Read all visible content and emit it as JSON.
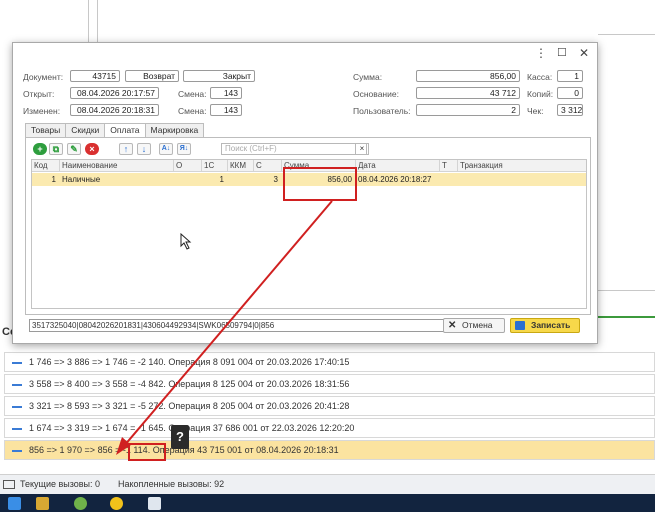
{
  "dialog": {
    "controls": {
      "more": "⋮",
      "maximize": "☐",
      "close": "✕"
    },
    "document": {
      "label": "Документ:",
      "number": "43715",
      "type": "Возврат",
      "state": "Закрыт"
    },
    "opened": {
      "label": "Открыт:",
      "value": "08.04.2026 20:17:57",
      "shift_label": "Смена:",
      "shift": "143"
    },
    "changed": {
      "label": "Изменен:",
      "value": "08.04.2026 20:18:31",
      "shift_label": "Смена:",
      "shift": "143"
    },
    "sum": {
      "label": "Сумма:",
      "value": "856,00"
    },
    "basis": {
      "label": "Основание:",
      "value": "43 712"
    },
    "user": {
      "label": "Пользователь:",
      "value": "2"
    },
    "cashbox": {
      "label": "Касса:",
      "value": "1"
    },
    "copies": {
      "label": "Копий:",
      "value": "0"
    },
    "check": {
      "label": "Чек:",
      "value": "3 312"
    },
    "tabs": [
      "Товары",
      "Скидки",
      "Оплата",
      "Маркировка"
    ],
    "search_placeholder": "Поиск (Ctrl+F)",
    "search_clear": "×",
    "grid": {
      "columns": [
        "Код",
        "Наименование",
        "О",
        "1С",
        "ККМ",
        "С",
        "Сумма",
        "Дата",
        "Т",
        "Транзакция"
      ],
      "row": {
        "code": "1",
        "name": "Наличные",
        "o": "",
        "c1": "1",
        "kkm": "",
        "s": "3",
        "sum": "856,00",
        "date": "08.04.2026 20:18:27",
        "t": "",
        "trans": ""
      }
    },
    "footer_text": "3517325040|08042026201831|430604492934|SWK06509794|0|856",
    "cancel_label": "Отмена",
    "save_label": "Записать"
  },
  "calls_header": "Co",
  "calls": [
    "1 746 => 3 886 => 1 746 = -2 140. Операция 8 091 004 от 20.03.2026 17:40:15",
    "3 558 => 8 400 => 3 558 = -4 842. Операция 8 125 004 от 20.03.2026 18:31:56",
    "3 321 => 8 593 => 3 321 = -5 272. Операция 8 205 004 от 20.03.2026 20:41:28",
    "1 674 => 3 319 => 1 674 = -1 645. Операция 37 686 001 от 22.03.2026 12:20:20",
    "856 => 1 970 => 856 = -1 114. Операция 43 715 001 от 08.04.2026 20:18:31"
  ],
  "help_mark": "?",
  "status": {
    "current": "Текущие вызовы: 0",
    "accumulated": "Накопленные вызовы: 92"
  },
  "colors": {
    "highlight": "#fbe3a0",
    "row_selected": "#fbeab0",
    "annotation": "#d02020",
    "save_button": "#f7d84a",
    "taskbar": "#12243f"
  }
}
